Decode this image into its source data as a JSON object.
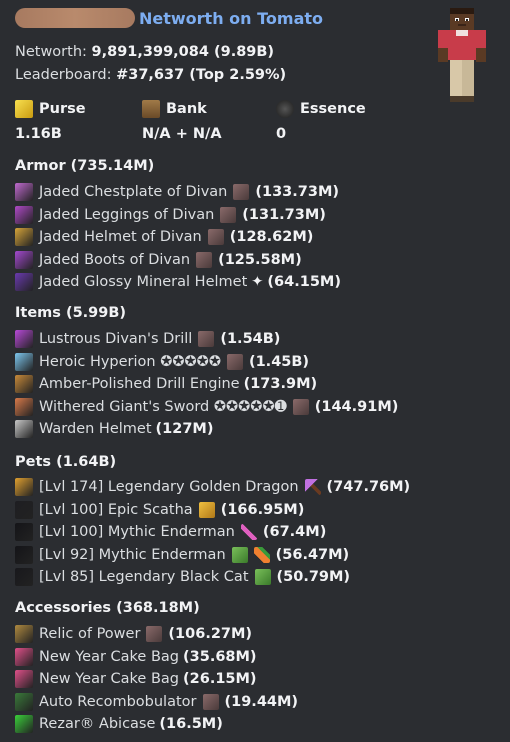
{
  "header": {
    "author_title": "Networth on Tomato"
  },
  "summary": {
    "networth_label": "Networth:",
    "networth_value": "9,891,399,084 (9.89B)",
    "leaderboard_label": "Leaderboard:",
    "leaderboard_value": "#37,637 (Top 2.59%)"
  },
  "fields": {
    "purse": {
      "label": "Purse",
      "value": "1.16B",
      "icon": "gold-ingot-icon",
      "color": "#e8c31c"
    },
    "bank": {
      "label": "Bank",
      "value": "N/A + N/A",
      "icon": "chest-icon",
      "color": "#8a6a3c"
    },
    "essence": {
      "label": "Essence",
      "value": "0",
      "icon": "essence-icon",
      "color": "#3a3a3a"
    }
  },
  "armor": {
    "title": "Armor (735.14M)",
    "items": [
      {
        "name": "Jaded Chestplate of Divan",
        "value": "(133.73M)",
        "icon": "chestplate-icon",
        "color": "#c06acf",
        "extra": "gemstone"
      },
      {
        "name": "Jaded Leggings of Divan",
        "value": "(131.73M)",
        "icon": "leggings-icon",
        "color": "#b04ac8",
        "extra": "gemstone"
      },
      {
        "name": "Jaded Helmet of Divan",
        "value": "(128.62M)",
        "icon": "helmet-icon",
        "color": "#d6a43a",
        "extra": "gemstone"
      },
      {
        "name": "Jaded Boots of Divan",
        "value": "(125.58M)",
        "icon": "boots-icon",
        "color": "#a44ad0",
        "extra": "gemstone"
      },
      {
        "name": "Jaded Glossy Mineral Helmet",
        "value": "(64.15M)",
        "icon": "mineral-helmet-icon",
        "color": "#6a3ab0",
        "extra": "sparkle"
      }
    ]
  },
  "items": {
    "title": "Items (5.99B)",
    "items": [
      {
        "name": "Lustrous Divan's Drill",
        "value": "(1.54B)",
        "icon": "drill-icon",
        "color": "#b84ad8",
        "extra": "gemstone"
      },
      {
        "name": "Heroic Hyperion ✪✪✪✪✪",
        "value": "(1.45B)",
        "icon": "sword-icon",
        "color": "#7ec8f0",
        "extra": "gemstone"
      },
      {
        "name": "Amber-Polished Drill Engine",
        "value": "(173.9M)",
        "icon": "engine-icon",
        "color": "#c88a3a",
        "extra": ""
      },
      {
        "name": "Withered Giant's Sword ✪✪✪✪✪➊",
        "value": "(144.91M)",
        "icon": "giant-sword-icon",
        "color": "#d87a4a",
        "extra": "gemstone"
      },
      {
        "name": "Warden Helmet",
        "value": "(127M)",
        "icon": "warden-helmet-icon",
        "color": "#c8c8c8",
        "extra": ""
      }
    ]
  },
  "pets": {
    "title": "Pets (1.64B)",
    "items": [
      {
        "name": "[Lvl 174] Legendary Golden Dragon",
        "value": "(747.76M)",
        "icon": "golden-dragon-icon",
        "color": "#e0a030",
        "extra": "pickaxe"
      },
      {
        "name": "[Lvl 100] Epic Scatha",
        "value": "(166.95M)",
        "icon": "scatha-icon",
        "color": "#1e1e22",
        "extra": "gold-block"
      },
      {
        "name": "[Lvl 100] Mythic Enderman",
        "value": "(67.4M)",
        "icon": "enderman-icon",
        "color": "#141418",
        "extra": "sword"
      },
      {
        "name": "[Lvl 92] Mythic Enderman",
        "value": "(56.47M)",
        "icon": "enderman-icon",
        "color": "#141418",
        "extra": "slime-carrot"
      },
      {
        "name": "[Lvl 85] Legendary Black Cat",
        "value": "(50.79M)",
        "icon": "black-cat-icon",
        "color": "#18181c",
        "extra": "slime"
      }
    ]
  },
  "accessories": {
    "title": "Accessories (368.18M)",
    "items": [
      {
        "name": "Relic of Power",
        "value": "(106.27M)",
        "icon": "relic-icon",
        "color": "#b08a40",
        "extra": "gemstone"
      },
      {
        "name": "New Year Cake Bag",
        "value": "(35.68M)",
        "icon": "cake-bag-icon",
        "color": "#e0508a",
        "extra": ""
      },
      {
        "name": "New Year Cake Bag",
        "value": "(26.15M)",
        "icon": "cake-bag-icon",
        "color": "#e0508a",
        "extra": ""
      },
      {
        "name": "Auto Recombobulator",
        "value": "(19.44M)",
        "icon": "recombobulator-icon",
        "color": "#3a7a3a",
        "extra": "gemstone"
      },
      {
        "name": "Rezar® Abicase",
        "value": "(16.5M)",
        "icon": "abicase-icon",
        "color": "#3ad03a",
        "extra": ""
      }
    ]
  }
}
